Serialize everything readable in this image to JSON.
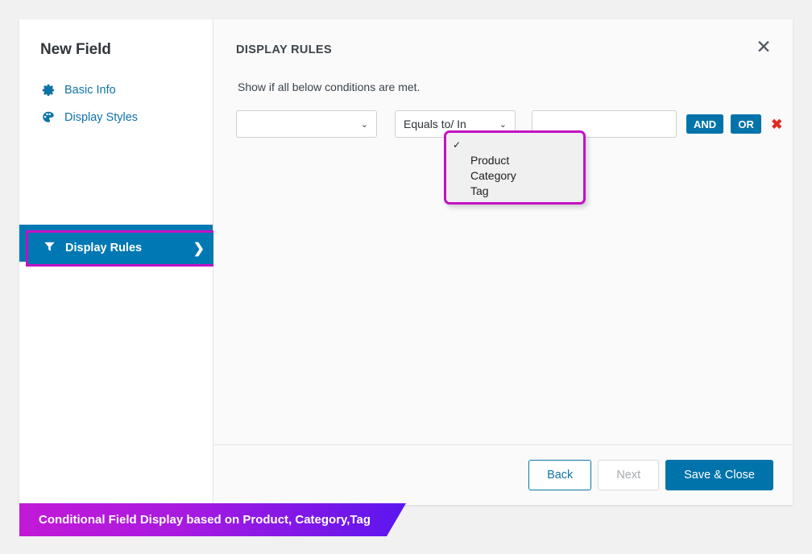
{
  "sidebar": {
    "title": "New Field",
    "items": [
      {
        "label": "Basic Info",
        "icon": "gear-icon",
        "active": false
      },
      {
        "label": "Display Styles",
        "icon": "palette-icon",
        "active": false
      },
      {
        "label": "Display Rules",
        "icon": "funnel-icon",
        "active": true,
        "chevron": "❯"
      }
    ]
  },
  "panel": {
    "title": "DISPLAY RULES",
    "close_label": "✕",
    "subtitle": "Show if all below conditions are met."
  },
  "rule_row": {
    "source_value": "",
    "operator_value": "Equals to/ In",
    "value_input": "",
    "value_placeholder": "",
    "caret": "⌄",
    "and_label": "AND",
    "or_label": "OR",
    "remove_label": "✖"
  },
  "dropdown": {
    "open": true,
    "checkmark": "✓",
    "options": [
      {
        "label": "",
        "selected": true
      },
      {
        "label": "Product",
        "selected": false
      },
      {
        "label": "Category",
        "selected": false
      },
      {
        "label": "Tag",
        "selected": false
      }
    ]
  },
  "footer": {
    "back_label": "Back",
    "next_label": "Next",
    "save_label": "Save & Close"
  },
  "ribbon": {
    "text": "Conditional Field Display based on Product, Category,Tag"
  },
  "colors": {
    "accent_blue": "#0073aa",
    "active_blue": "#0078b4",
    "highlight_magenta": "#c212c2",
    "danger_red": "#e02b20",
    "ribbon_start": "#c219d6",
    "ribbon_end": "#5b16f0"
  }
}
